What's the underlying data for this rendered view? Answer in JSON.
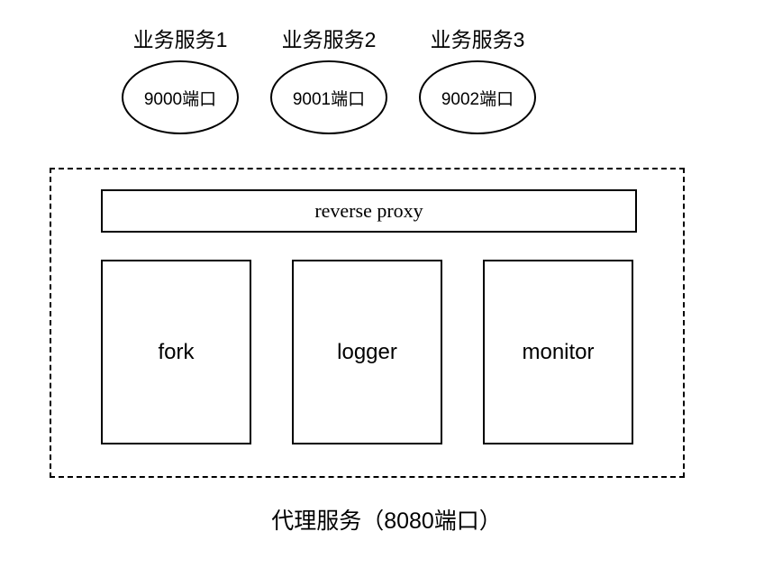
{
  "services": [
    {
      "label": "业务服务1",
      "port": "9000端口"
    },
    {
      "label": "业务服务2",
      "port": "9001端口"
    },
    {
      "label": "业务服务3",
      "port": "9002端口"
    }
  ],
  "proxy": {
    "reverseProxyLabel": "reverse proxy",
    "modules": [
      {
        "label": "fork"
      },
      {
        "label": "logger"
      },
      {
        "label": "monitor"
      }
    ],
    "caption": "代理服务（8080端口）"
  }
}
